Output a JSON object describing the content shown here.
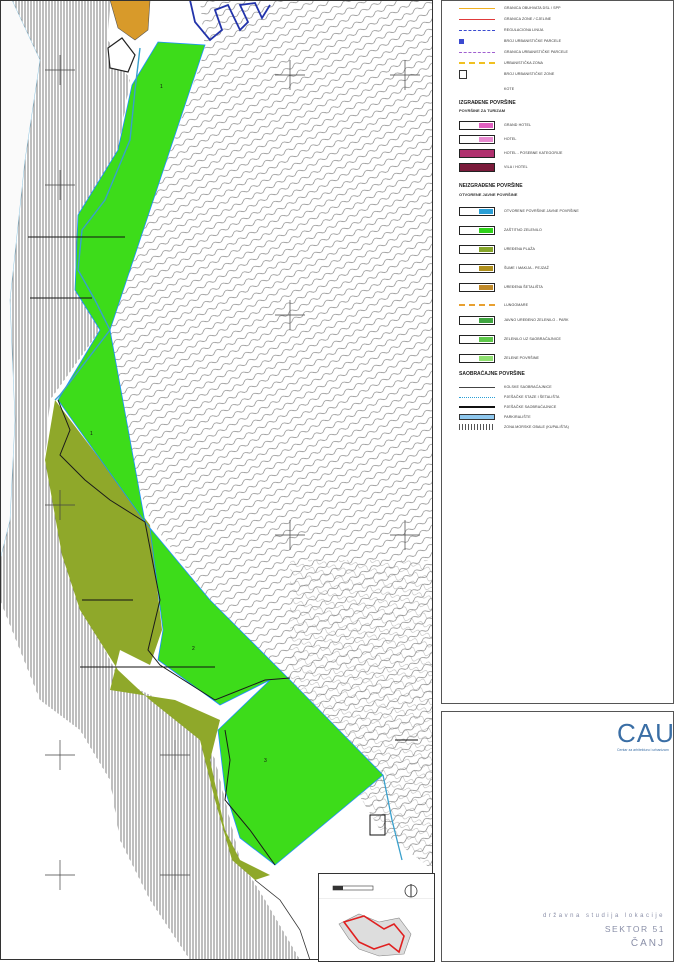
{
  "legend": {
    "top_items": [
      {
        "label": "GRANICA OBUHVATA DSL / SPP",
        "icon": "line-orange"
      },
      {
        "label": "GRANICA ZONE / CJELINE",
        "icon": "line-red"
      },
      {
        "label": "REGULACIONA LINIJA",
        "icon": "line-blue-dash"
      },
      {
        "label": "BROJ URBANISTIČKE PARCELE",
        "icon": "square-blue"
      },
      {
        "label": "GRANICA URBANISTIČKE PARCELE",
        "icon": "line-purple-dash"
      },
      {
        "label": "URBANISTIČKA ZONA",
        "icon": "line-yellow-dash"
      },
      {
        "label": "BROJ URBANISTIČKE ZONE",
        "icon": "box-num"
      },
      {
        "label": "KOTE",
        "icon": "none"
      }
    ],
    "built_heading": "IZGRAĐENE POVRŠINE",
    "tourism_heading": "POVRŠINE ZA TURIZAM",
    "tourism_items": [
      {
        "label": "GRAND HOTEL",
        "color": "#e060c0"
      },
      {
        "label": "HOTEL",
        "color": "#e88ad0"
      },
      {
        "label": "HOTEL - POSEBNE KATEGORIJE",
        "color": "#b0306e"
      },
      {
        "label": "VILA / HOTEL",
        "color": "#7a1a3a"
      }
    ],
    "unbuilt_heading": "NEIZGRAĐENE POVRŠINE",
    "public_heading": "OTVORENE JAVNE POVRŠINE",
    "public_items": [
      {
        "label": "OTVORENE POVRŠINE JAVNE POVRŠINE",
        "color": "#2a9fd6"
      },
      {
        "label": "ZAŠTITNO ZELENILO",
        "color": "#2fd21a"
      },
      {
        "label": "UREĐENA PLAŽA",
        "color": "#86a62a"
      },
      {
        "label": "ŠUME I MAKIJA - PEJZAŽ",
        "color": "#b0901c"
      },
      {
        "label": "UREĐENA ŠETALIŠTA",
        "color": "#c08a2a"
      },
      {
        "label": "LUNGOMARE",
        "color": "#e8a030"
      },
      {
        "label": "JAVNO UREĐENO ZELENILO - PARK",
        "color": "#3fa540"
      },
      {
        "label": "ZELENILO UZ SAOBRAĆAJNICE",
        "color": "#5ec84a"
      },
      {
        "label": "ZELENE POVRŠINE",
        "color": "#8fe070"
      }
    ],
    "traffic_heading": "SAOBRAĆAJNE POVRŠINE",
    "traffic_items": [
      {
        "label": "KOLSKE SAOBRAĆAJNICE",
        "icon": "line-thin"
      },
      {
        "label": "PJEŠAČKE STAZE I ŠETALIŠTA",
        "icon": "line-blue-dot"
      },
      {
        "label": "PJEŠAČKE SAOBRAĆAJNICE",
        "icon": "line-thick"
      },
      {
        "label": "PARKIRALIŠTE",
        "icon": "box-lightblue"
      },
      {
        "label": "ZONA MORSKE OBALE (KUPALIŠTA)",
        "icon": "hatch"
      }
    ]
  },
  "title_block": {
    "logo": "CAU",
    "logo_subtitle": "Centar za arhitekturu i urbanizam",
    "study": "državna studija lokacije",
    "sector": "SEKTOR 51",
    "place": "ČANJ"
  },
  "map": {
    "colors": {
      "green_zone": "#3ddc1a",
      "olive_zone": "#8fa82a",
      "sea_hatch": "#777777",
      "contour": "#555555",
      "shoreline": "#3aa0cc",
      "parcel_border": "#1e90ff",
      "orange_zone": "#d89a2a"
    },
    "parcel_labels": [
      "1",
      "1",
      "2",
      "3"
    ]
  }
}
